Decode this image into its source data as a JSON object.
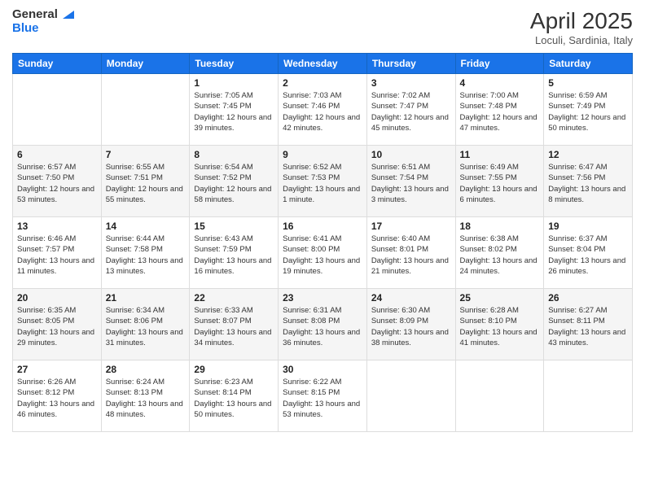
{
  "header": {
    "logo_line1": "General",
    "logo_line2": "Blue",
    "month": "April 2025",
    "location": "Loculi, Sardinia, Italy"
  },
  "weekdays": [
    "Sunday",
    "Monday",
    "Tuesday",
    "Wednesday",
    "Thursday",
    "Friday",
    "Saturday"
  ],
  "rows": [
    [
      {
        "day": "",
        "sunrise": "",
        "sunset": "",
        "daylight": ""
      },
      {
        "day": "",
        "sunrise": "",
        "sunset": "",
        "daylight": ""
      },
      {
        "day": "1",
        "sunrise": "Sunrise: 7:05 AM",
        "sunset": "Sunset: 7:45 PM",
        "daylight": "Daylight: 12 hours and 39 minutes."
      },
      {
        "day": "2",
        "sunrise": "Sunrise: 7:03 AM",
        "sunset": "Sunset: 7:46 PM",
        "daylight": "Daylight: 12 hours and 42 minutes."
      },
      {
        "day": "3",
        "sunrise": "Sunrise: 7:02 AM",
        "sunset": "Sunset: 7:47 PM",
        "daylight": "Daylight: 12 hours and 45 minutes."
      },
      {
        "day": "4",
        "sunrise": "Sunrise: 7:00 AM",
        "sunset": "Sunset: 7:48 PM",
        "daylight": "Daylight: 12 hours and 47 minutes."
      },
      {
        "day": "5",
        "sunrise": "Sunrise: 6:59 AM",
        "sunset": "Sunset: 7:49 PM",
        "daylight": "Daylight: 12 hours and 50 minutes."
      }
    ],
    [
      {
        "day": "6",
        "sunrise": "Sunrise: 6:57 AM",
        "sunset": "Sunset: 7:50 PM",
        "daylight": "Daylight: 12 hours and 53 minutes."
      },
      {
        "day": "7",
        "sunrise": "Sunrise: 6:55 AM",
        "sunset": "Sunset: 7:51 PM",
        "daylight": "Daylight: 12 hours and 55 minutes."
      },
      {
        "day": "8",
        "sunrise": "Sunrise: 6:54 AM",
        "sunset": "Sunset: 7:52 PM",
        "daylight": "Daylight: 12 hours and 58 minutes."
      },
      {
        "day": "9",
        "sunrise": "Sunrise: 6:52 AM",
        "sunset": "Sunset: 7:53 PM",
        "daylight": "Daylight: 13 hours and 1 minute."
      },
      {
        "day": "10",
        "sunrise": "Sunrise: 6:51 AM",
        "sunset": "Sunset: 7:54 PM",
        "daylight": "Daylight: 13 hours and 3 minutes."
      },
      {
        "day": "11",
        "sunrise": "Sunrise: 6:49 AM",
        "sunset": "Sunset: 7:55 PM",
        "daylight": "Daylight: 13 hours and 6 minutes."
      },
      {
        "day": "12",
        "sunrise": "Sunrise: 6:47 AM",
        "sunset": "Sunset: 7:56 PM",
        "daylight": "Daylight: 13 hours and 8 minutes."
      }
    ],
    [
      {
        "day": "13",
        "sunrise": "Sunrise: 6:46 AM",
        "sunset": "Sunset: 7:57 PM",
        "daylight": "Daylight: 13 hours and 11 minutes."
      },
      {
        "day": "14",
        "sunrise": "Sunrise: 6:44 AM",
        "sunset": "Sunset: 7:58 PM",
        "daylight": "Daylight: 13 hours and 13 minutes."
      },
      {
        "day": "15",
        "sunrise": "Sunrise: 6:43 AM",
        "sunset": "Sunset: 7:59 PM",
        "daylight": "Daylight: 13 hours and 16 minutes."
      },
      {
        "day": "16",
        "sunrise": "Sunrise: 6:41 AM",
        "sunset": "Sunset: 8:00 PM",
        "daylight": "Daylight: 13 hours and 19 minutes."
      },
      {
        "day": "17",
        "sunrise": "Sunrise: 6:40 AM",
        "sunset": "Sunset: 8:01 PM",
        "daylight": "Daylight: 13 hours and 21 minutes."
      },
      {
        "day": "18",
        "sunrise": "Sunrise: 6:38 AM",
        "sunset": "Sunset: 8:02 PM",
        "daylight": "Daylight: 13 hours and 24 minutes."
      },
      {
        "day": "19",
        "sunrise": "Sunrise: 6:37 AM",
        "sunset": "Sunset: 8:04 PM",
        "daylight": "Daylight: 13 hours and 26 minutes."
      }
    ],
    [
      {
        "day": "20",
        "sunrise": "Sunrise: 6:35 AM",
        "sunset": "Sunset: 8:05 PM",
        "daylight": "Daylight: 13 hours and 29 minutes."
      },
      {
        "day": "21",
        "sunrise": "Sunrise: 6:34 AM",
        "sunset": "Sunset: 8:06 PM",
        "daylight": "Daylight: 13 hours and 31 minutes."
      },
      {
        "day": "22",
        "sunrise": "Sunrise: 6:33 AM",
        "sunset": "Sunset: 8:07 PM",
        "daylight": "Daylight: 13 hours and 34 minutes."
      },
      {
        "day": "23",
        "sunrise": "Sunrise: 6:31 AM",
        "sunset": "Sunset: 8:08 PM",
        "daylight": "Daylight: 13 hours and 36 minutes."
      },
      {
        "day": "24",
        "sunrise": "Sunrise: 6:30 AM",
        "sunset": "Sunset: 8:09 PM",
        "daylight": "Daylight: 13 hours and 38 minutes."
      },
      {
        "day": "25",
        "sunrise": "Sunrise: 6:28 AM",
        "sunset": "Sunset: 8:10 PM",
        "daylight": "Daylight: 13 hours and 41 minutes."
      },
      {
        "day": "26",
        "sunrise": "Sunrise: 6:27 AM",
        "sunset": "Sunset: 8:11 PM",
        "daylight": "Daylight: 13 hours and 43 minutes."
      }
    ],
    [
      {
        "day": "27",
        "sunrise": "Sunrise: 6:26 AM",
        "sunset": "Sunset: 8:12 PM",
        "daylight": "Daylight: 13 hours and 46 minutes."
      },
      {
        "day": "28",
        "sunrise": "Sunrise: 6:24 AM",
        "sunset": "Sunset: 8:13 PM",
        "daylight": "Daylight: 13 hours and 48 minutes."
      },
      {
        "day": "29",
        "sunrise": "Sunrise: 6:23 AM",
        "sunset": "Sunset: 8:14 PM",
        "daylight": "Daylight: 13 hours and 50 minutes."
      },
      {
        "day": "30",
        "sunrise": "Sunrise: 6:22 AM",
        "sunset": "Sunset: 8:15 PM",
        "daylight": "Daylight: 13 hours and 53 minutes."
      },
      {
        "day": "",
        "sunrise": "",
        "sunset": "",
        "daylight": ""
      },
      {
        "day": "",
        "sunrise": "",
        "sunset": "",
        "daylight": ""
      },
      {
        "day": "",
        "sunrise": "",
        "sunset": "",
        "daylight": ""
      }
    ]
  ]
}
